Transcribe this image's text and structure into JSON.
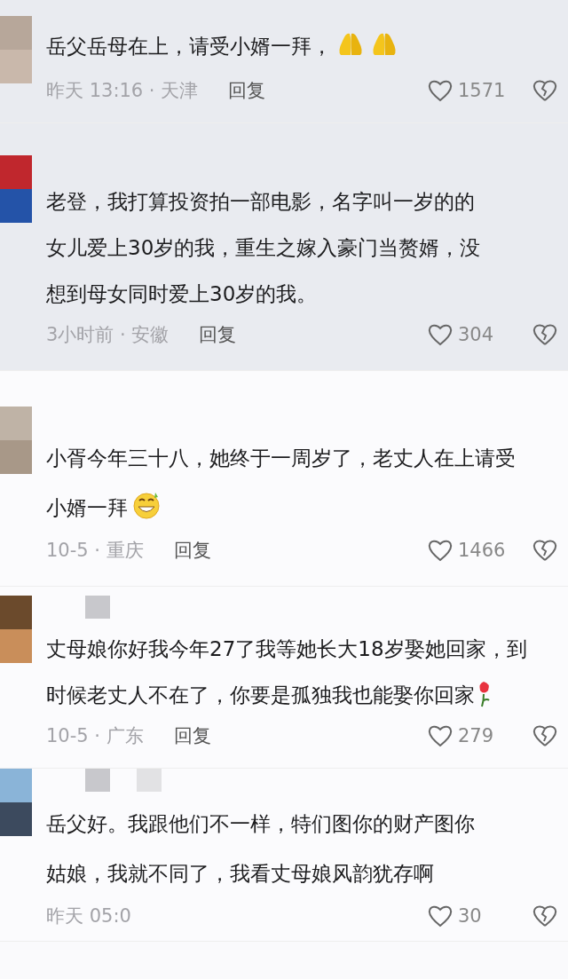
{
  "comments": [
    {
      "shaded": true,
      "lines": [
        "岳父岳母在上，请受小婿一拜，"
      ],
      "emoji": [
        {
          "kind": "pray"
        },
        {
          "kind": "pray"
        }
      ],
      "time": "昨天 13:16 · 天津",
      "reply": "回复",
      "likes": "1571"
    },
    {
      "shaded": true,
      "lines": [
        "老登，我打算投资拍一部电影，名字叫一岁的的",
        "女儿爱上30岁的我，重生之嫁入豪门当赘婿，没",
        "想到母女同时爱上30岁的我。"
      ],
      "time": "3小时前 · 安徽",
      "reply": "回复",
      "likes": "304"
    },
    {
      "shaded": false,
      "lines": [
        "小胥今年三十八，她终于一周岁了，老丈人在上请受",
        "小婿一拜"
      ],
      "emoji": [
        {
          "kind": "grin"
        }
      ],
      "time": "10-5 · 重庆",
      "reply": "回复",
      "likes": "1466"
    },
    {
      "shaded": false,
      "name_blocks": [
        {
          "kind": "dark"
        }
      ],
      "lines": [
        "丈母娘你好我今年27了我等她长大18岁娶她回家，到",
        "时候老丈人不在了，你要是孤独我也能娶你回家"
      ],
      "emoji": [
        {
          "kind": "rose"
        }
      ],
      "time": "10-5 · 广东",
      "reply": "回复",
      "likes": "279"
    },
    {
      "shaded": false,
      "name_blocks": [
        {
          "kind": "dark"
        },
        {
          "kind": "light"
        }
      ],
      "lines": [
        "岳父好。我跟他们不一样，特们图你的财产图你",
        "姑娘，我就不同了，我看丈母娘风韵犹存啊"
      ],
      "time": "昨天 05:0",
      "likes": "30"
    }
  ]
}
